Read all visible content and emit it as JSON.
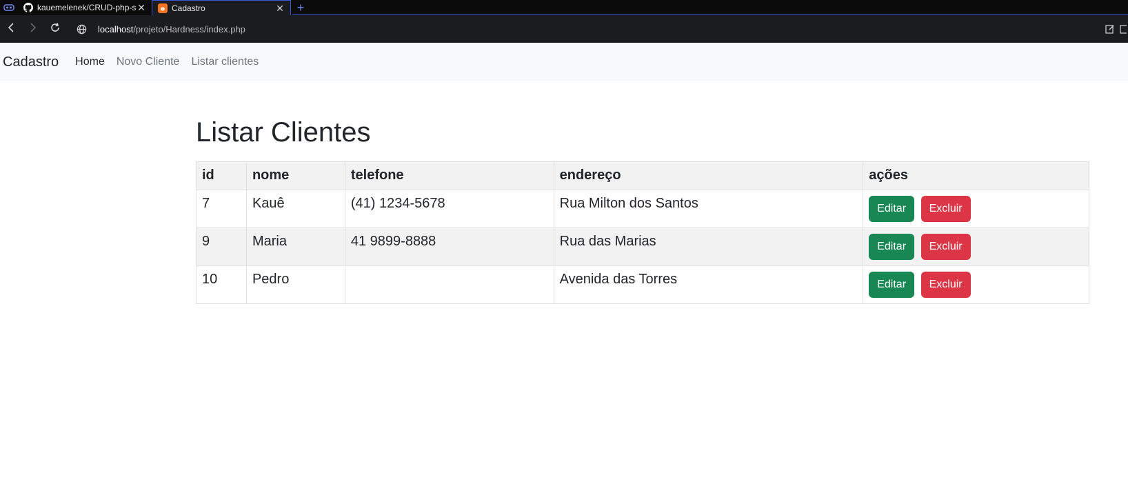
{
  "browser": {
    "tabs": [
      {
        "title": "kauemelenek/CRUD-php-si",
        "icon": "github-icon",
        "active": false
      },
      {
        "title": "Cadastro",
        "icon": "xampp-icon",
        "active": true
      }
    ],
    "new_tab_label": "+",
    "url_host": "localhost",
    "url_path": "/projeto/Hardness/index.php"
  },
  "navbar": {
    "brand": "Cadastro",
    "links": [
      {
        "label": "Home",
        "active": true
      },
      {
        "label": "Novo Cliente",
        "active": false
      },
      {
        "label": "Listar clientes",
        "active": false
      }
    ]
  },
  "main": {
    "title": "Listar Clientes",
    "table": {
      "headers": [
        "id",
        "nome",
        "telefone",
        "endereço",
        "ações"
      ],
      "rows": [
        {
          "id": "7",
          "nome": "Kauê",
          "telefone": "(41) 1234-5678",
          "endereco": "Rua Milton dos Santos"
        },
        {
          "id": "9",
          "nome": "Maria",
          "telefone": "41 9899-8888",
          "endereco": "Rua das Marias"
        },
        {
          "id": "10",
          "nome": "Pedro",
          "telefone": "",
          "endereco": "Avenida das Torres"
        }
      ],
      "edit_label": "Editar",
      "delete_label": "Excluir"
    }
  },
  "colors": {
    "edit": "#198754",
    "delete": "#dc3545",
    "navbar_bg": "#f8f9fa",
    "tab_accent": "#3a5bd9"
  }
}
